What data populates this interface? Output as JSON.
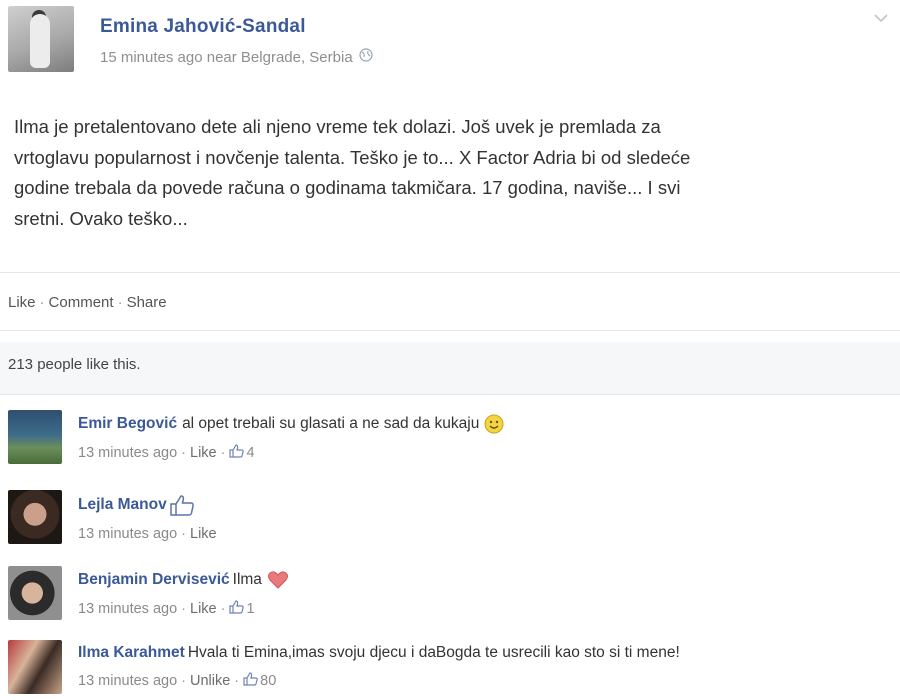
{
  "post": {
    "author": "Emina Jahović-Sandal",
    "meta": "15 minutes ago near Belgrade, Serbia",
    "text_lines": [
      "Ilma je pretalentovano dete ali njeno vreme tek dolazi. Još uvek je premlada za",
      "vrtoglavu popularnost i novčenje talenta. Teško je to... X Factor Adria bi od sledeće",
      "godine trebala da povede računa o godinama takmičara. 17 godina, naviše... I svi",
      "sretni. Ovako teško..."
    ],
    "actions": {
      "like": "Like",
      "comment": "Comment",
      "share": "Share"
    },
    "likes_text": "213 people like this."
  },
  "comments": [
    {
      "name": "Emir Begović",
      "text": "al opet trebali su glasati a ne sad da kukaju",
      "time": "13 minutes ago",
      "action": "Like",
      "likes": "4"
    },
    {
      "name": "Lejla Manov",
      "text": "",
      "time": "13 minutes ago",
      "action": "Like"
    },
    {
      "name": "Benjamin Dervisević",
      "text": "Ilma",
      "time": "13 minutes ago",
      "action": "Like",
      "likes": "1"
    },
    {
      "name": "Ilma Karahmet",
      "text": "Hvala ti Emina,imas svoju djecu i daBogda te usrecili kao sto si ti mene!",
      "time": "13 minutes ago",
      "action": "Unlike",
      "likes": "80"
    }
  ],
  "colors": {
    "name_blue": "#3b5998",
    "meta_gray": "#8f8f8f",
    "heart": "#e9797a",
    "smiley": "#f6d43c"
  },
  "icons": [
    "globe-icon",
    "chevron-down-icon",
    "thumbs-up-icon",
    "smiley-icon",
    "heart-icon"
  ]
}
